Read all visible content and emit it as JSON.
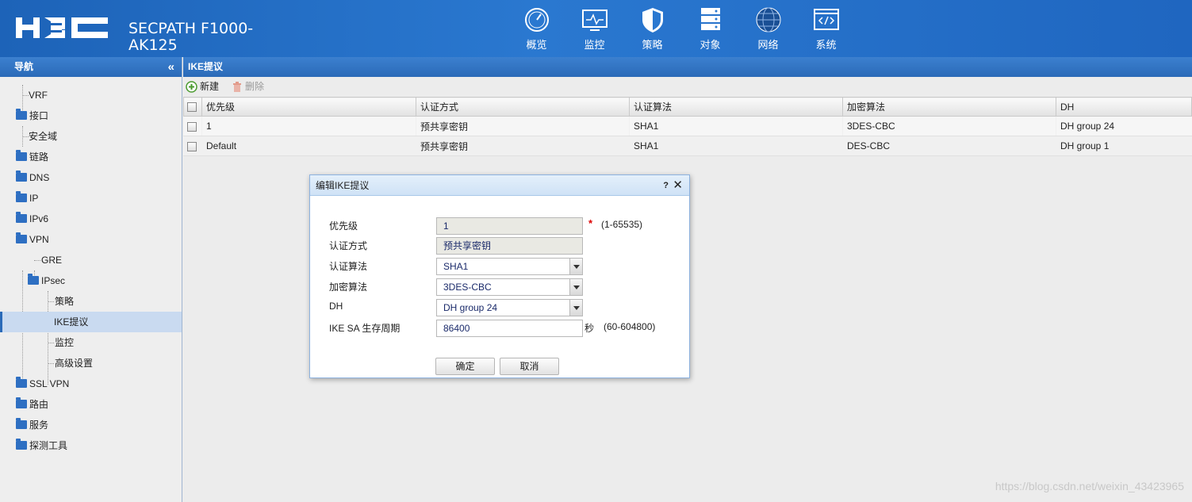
{
  "header": {
    "product_line1": "SECPATH F1000-",
    "product_line2": "AK125",
    "nav": [
      {
        "label": "概览",
        "icon": "dashboard-icon"
      },
      {
        "label": "监控",
        "icon": "monitor-icon"
      },
      {
        "label": "策略",
        "icon": "shield-icon"
      },
      {
        "label": "对象",
        "icon": "server-stack-icon"
      },
      {
        "label": "网络",
        "icon": "internet-globe-icon"
      },
      {
        "label": "系统",
        "icon": "code-window-icon"
      }
    ]
  },
  "sidebar": {
    "title": "导航",
    "collapse": "«",
    "items": [
      {
        "label": "VRF",
        "type": "leaf"
      },
      {
        "label": "接口",
        "type": "folder"
      },
      {
        "label": "安全域",
        "type": "leaf"
      },
      {
        "label": "链路",
        "type": "folder"
      },
      {
        "label": "DNS",
        "type": "folder"
      },
      {
        "label": "IP",
        "type": "folder"
      },
      {
        "label": "IPv6",
        "type": "folder"
      },
      {
        "label": "VPN",
        "type": "folder-open"
      },
      {
        "label": "GRE",
        "type": "leaf"
      },
      {
        "label": "IPsec",
        "type": "folder-open"
      },
      {
        "label": "策略",
        "type": "leaf"
      },
      {
        "label": "IKE提议",
        "type": "leaf",
        "selected": true
      },
      {
        "label": "监控",
        "type": "leaf"
      },
      {
        "label": "高级设置",
        "type": "leaf"
      },
      {
        "label": "SSL VPN",
        "type": "folder"
      },
      {
        "label": "路由",
        "type": "folder"
      },
      {
        "label": "服务",
        "type": "folder"
      },
      {
        "label": "探测工具",
        "type": "folder"
      }
    ]
  },
  "main": {
    "title": "IKE提议",
    "toolbar": {
      "new_label": "新建",
      "delete_label": "删除"
    },
    "table": {
      "columns": [
        "优先级",
        "认证方式",
        "认证算法",
        "加密算法",
        "DH"
      ],
      "rows": [
        [
          "1",
          "预共享密钥",
          "SHA1",
          "3DES-CBC",
          "DH group 24"
        ],
        [
          "Default",
          "预共享密钥",
          "SHA1",
          "DES-CBC",
          "DH group 1"
        ]
      ]
    }
  },
  "dialog": {
    "title": "编辑IKE提议",
    "help": "?",
    "close": "✕",
    "priority": {
      "label": "优先级",
      "value": "1",
      "required": "*",
      "hint": "(1-65535)"
    },
    "auth_method": {
      "label": "认证方式",
      "value": "预共享密钥"
    },
    "auth_alg": {
      "label": "认证算法",
      "value": "SHA1"
    },
    "enc_alg": {
      "label": "加密算法",
      "value": "3DES-CBC"
    },
    "dh": {
      "label": "DH",
      "value": "DH group 24"
    },
    "lifetime": {
      "label": "IKE SA 生存周期",
      "value": "86400",
      "unit": "秒",
      "hint": "(60-604800)"
    },
    "ok_label": "确定",
    "cancel_label": "取消"
  },
  "watermark": "https://blog.csdn.net/weixin_43423965",
  "colors": {
    "header_blue": "#2a78d0",
    "required_red": "#dd0000",
    "selection": "#c9daf0"
  }
}
